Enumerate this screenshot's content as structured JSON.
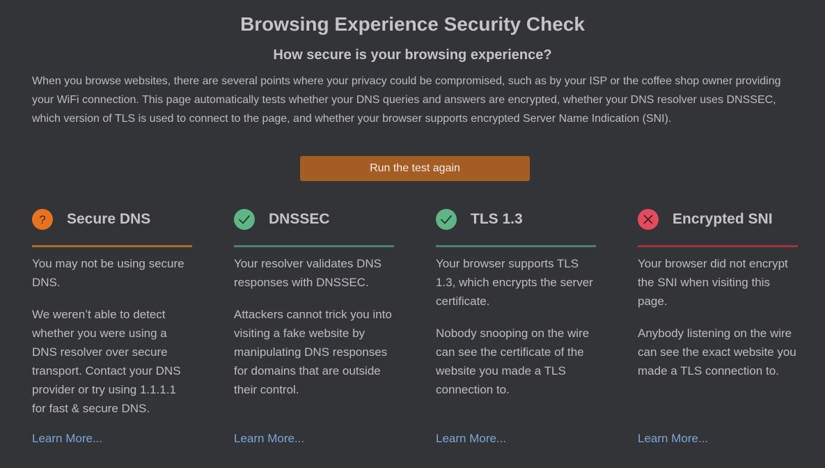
{
  "header": {
    "title": "Browsing Experience Security Check",
    "subtitle": "How secure is your browsing experience?",
    "intro": "When you browse websites, there are several points where your privacy could be compromised, such as by your ISP or the coffee shop owner providing your WiFi connection. This page automatically tests whether your DNS queries and answers are encrypted, whether your DNS resolver uses DNSSEC, which version of TLS is used to connect to the page, and whether your browser supports encrypted Server Name Indication (SNI)."
  },
  "actions": {
    "run_label": "Run the test again"
  },
  "colors": {
    "background": "#333437",
    "accent_button": "#a55d24",
    "unknown": "#e8731f",
    "unknown_line": "#b46a2a",
    "pass": "#5fb585",
    "pass_line": "#4c8464",
    "fail": "#e34c5e",
    "fail_line": "#a5333f",
    "link": "#7aa7d8"
  },
  "cards": [
    {
      "status": "unknown",
      "icon": "question-icon",
      "title": "Secure DNS",
      "summary": "You may not be using secure DNS.",
      "detail": "We weren’t able to detect whether you were using a DNS resolver over secure transport. Contact your DNS provider or try using 1.1.1.1 for fast & secure DNS.",
      "link": "Learn More..."
    },
    {
      "status": "pass",
      "icon": "check-icon",
      "title": "DNSSEC",
      "summary": "Your resolver validates DNS responses with DNSSEC.",
      "detail": "Attackers cannot trick you into visiting a fake website by manipulating DNS responses for domains that are outside their control.",
      "link": "Learn More..."
    },
    {
      "status": "pass",
      "icon": "check-icon",
      "title": "TLS 1.3",
      "summary": "Your browser supports TLS 1.3, which encrypts the server certificate.",
      "detail": "Nobody snooping on the wire can see the certificate of the website you made a TLS connection to.",
      "link": "Learn More..."
    },
    {
      "status": "fail",
      "icon": "x-icon",
      "title": "Encrypted SNI",
      "summary": "Your browser did not encrypt the SNI when visiting this page.",
      "detail": "Anybody listening on the wire can see the exact website you made a TLS connection to.",
      "link": "Learn More..."
    }
  ]
}
